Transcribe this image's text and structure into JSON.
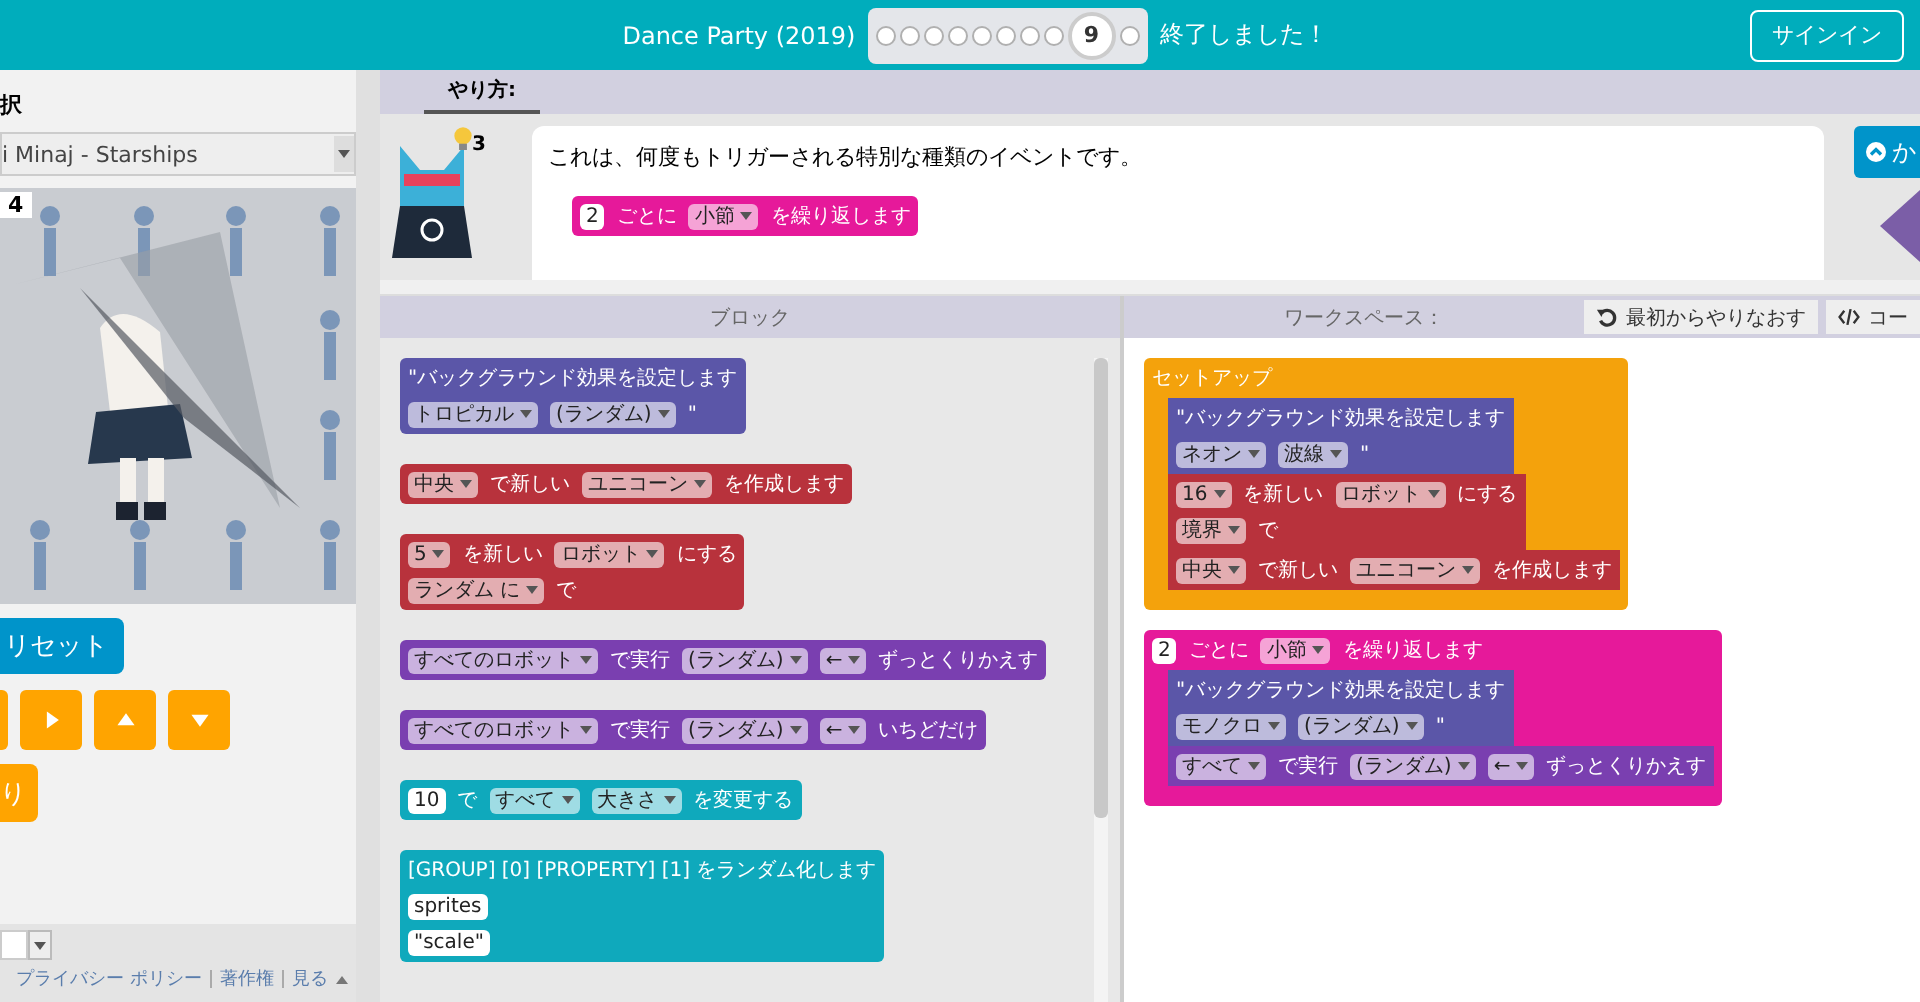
{
  "header": {
    "title": "Dance Party (2019)",
    "levels": [
      {
        "selected": false
      },
      {
        "selected": false
      },
      {
        "selected": false
      },
      {
        "selected": false
      },
      {
        "selected": false
      },
      {
        "selected": false
      },
      {
        "selected": false
      },
      {
        "selected": false
      },
      {
        "label": "9",
        "selected": true
      },
      {
        "selected": false
      }
    ],
    "status": "終了しました！",
    "sign_in": "サインイン"
  },
  "left_panel": {
    "song_label": "択",
    "song_select": "i Minaj - Starships",
    "stage": {
      "kind": "picture",
      "counter": "4"
    },
    "reset_button": "リセット",
    "arrow_buttons": [
      {
        "kind": "edge"
      },
      {
        "kind": "right"
      },
      {
        "kind": "up"
      },
      {
        "kind": "down"
      }
    ],
    "finish_button": "り",
    "footer_links": [
      "プライバシー ポリシー",
      "著作権",
      "見る"
    ]
  },
  "instructions": {
    "tab": "やり方:",
    "hint_count": "3",
    "text": "これは、何度もトリガーされる特別な種類のイベントです。",
    "example_block": {
      "color": "#e6199a",
      "lines": [
        [
          {
            "kind": "field",
            "text": "2"
          },
          {
            "kind": "label",
            "text": "ごとに"
          },
          {
            "kind": "dropdown",
            "text": "小節"
          },
          {
            "kind": "label",
            "text": "を繰り返します"
          }
        ]
      ]
    },
    "collapse_button": "か"
  },
  "toolbox": {
    "title": "ブロック",
    "blocks": [
      {
        "color": "#5b56a8",
        "lines": [
          [
            {
              "kind": "label",
              "text": "\"バックグラウンド効果を設定します"
            }
          ],
          [
            {
              "kind": "dropdown",
              "text": "トロピカル"
            },
            {
              "kind": "dropdown",
              "text": "(ランダム)"
            },
            {
              "kind": "label",
              "text": "\""
            }
          ]
        ]
      },
      {
        "color": "#b8323c",
        "lines": [
          [
            {
              "kind": "dropdown",
              "text": "中央"
            },
            {
              "kind": "label",
              "text": "で新しい"
            },
            {
              "kind": "dropdown",
              "text": "ユニコーン"
            },
            {
              "kind": "label",
              "text": "を作成します"
            }
          ]
        ]
      },
      {
        "color": "#b8323c",
        "lines": [
          [
            {
              "kind": "dropdown",
              "text": "5"
            },
            {
              "kind": "label",
              "text": "を新しい"
            },
            {
              "kind": "dropdown",
              "text": "ロボット"
            },
            {
              "kind": "label",
              "text": "にする"
            }
          ],
          [
            {
              "kind": "dropdown",
              "text": "ランダム に"
            },
            {
              "kind": "label",
              "text": "で"
            }
          ]
        ]
      },
      {
        "color": "#7a3fb0",
        "lines": [
          [
            {
              "kind": "dropdown",
              "text": "すべてのロボット"
            },
            {
              "kind": "label",
              "text": "で実行"
            },
            {
              "kind": "dropdown",
              "text": "(ランダム)"
            },
            {
              "kind": "dropdown",
              "text": "←"
            },
            {
              "kind": "label",
              "text": "ずっとくりかえす"
            }
          ]
        ]
      },
      {
        "color": "#7a3fb0",
        "lines": [
          [
            {
              "kind": "dropdown",
              "text": "すべてのロボット"
            },
            {
              "kind": "label",
              "text": "で実行"
            },
            {
              "kind": "dropdown",
              "text": "(ランダム)"
            },
            {
              "kind": "dropdown",
              "text": "←"
            },
            {
              "kind": "label",
              "text": "いちどだけ"
            }
          ]
        ]
      },
      {
        "color": "#0fa9bc",
        "lines": [
          [
            {
              "kind": "field",
              "text": "10"
            },
            {
              "kind": "label",
              "text": "で"
            },
            {
              "kind": "dropdown",
              "text": "すべて"
            },
            {
              "kind": "dropdown",
              "text": "大きさ"
            },
            {
              "kind": "label",
              "text": "を変更する"
            }
          ]
        ]
      },
      {
        "color": "#0fa9bc",
        "lines": [
          [
            {
              "kind": "label",
              "text": "[GROUP] [0] [PROPERTY] [1] をランダム化します"
            }
          ],
          [
            {
              "kind": "field",
              "text": "sprites"
            }
          ],
          [
            {
              "kind": "field",
              "text": "\"scale\""
            }
          ]
        ]
      }
    ]
  },
  "workspace": {
    "title": "ワークスペース：",
    "buttons": [
      {
        "kind": "restart",
        "label": "最初からやりなおす"
      },
      {
        "kind": "code",
        "label": "コー"
      }
    ],
    "blocks": [
      {
        "color": "#f4a20c",
        "lines": [
          [
            {
              "kind": "label",
              "text": "セットアップ"
            }
          ]
        ],
        "children": [
          {
            "color": "#5b56a8",
            "lines": [
              [
                {
                  "kind": "label",
                  "text": "\"バックグラウンド効果を設定します"
                }
              ],
              [
                {
                  "kind": "dropdown",
                  "text": "ネオン"
                },
                {
                  "kind": "dropdown",
                  "text": "波線"
                },
                {
                  "kind": "label",
                  "text": "\""
                }
              ]
            ]
          },
          {
            "color": "#b8323c",
            "lines": [
              [
                {
                  "kind": "dropdown",
                  "text": "16"
                },
                {
                  "kind": "label",
                  "text": "を新しい"
                },
                {
                  "kind": "dropdown",
                  "text": "ロボット"
                },
                {
                  "kind": "label",
                  "text": "にする"
                }
              ],
              [
                {
                  "kind": "dropdown",
                  "text": "境界"
                },
                {
                  "kind": "label",
                  "text": "で"
                }
              ]
            ]
          },
          {
            "color": "#b8323c",
            "lines": [
              [
                {
                  "kind": "dropdown",
                  "text": "中央"
                },
                {
                  "kind": "label",
                  "text": "で新しい"
                },
                {
                  "kind": "dropdown",
                  "text": "ユニコーン"
                },
                {
                  "kind": "label",
                  "text": "を作成します"
                }
              ]
            ]
          }
        ]
      },
      {
        "color": "#e6199a",
        "lines": [
          [
            {
              "kind": "field",
              "text": "2"
            },
            {
              "kind": "label",
              "text": "ごとに"
            },
            {
              "kind": "dropdown",
              "text": "小節"
            },
            {
              "kind": "label",
              "text": "を繰り返します"
            }
          ]
        ],
        "children": [
          {
            "color": "#5b56a8",
            "lines": [
              [
                {
                  "kind": "label",
                  "text": "\"バックグラウンド効果を設定します"
                }
              ],
              [
                {
                  "kind": "dropdown",
                  "text": "モノクロ"
                },
                {
                  "kind": "dropdown",
                  "text": "(ランダム)"
                },
                {
                  "kind": "label",
                  "text": "\""
                }
              ]
            ]
          },
          {
            "color": "#7a3fb0",
            "lines": [
              [
                {
                  "kind": "dropdown",
                  "text": "すべて"
                },
                {
                  "kind": "label",
                  "text": "で実行"
                },
                {
                  "kind": "dropdown",
                  "text": "(ランダム)"
                },
                {
                  "kind": "dropdown",
                  "text": "←"
                },
                {
                  "kind": "label",
                  "text": "ずっとくりかえす"
                }
              ]
            ]
          }
        ]
      }
    ]
  }
}
